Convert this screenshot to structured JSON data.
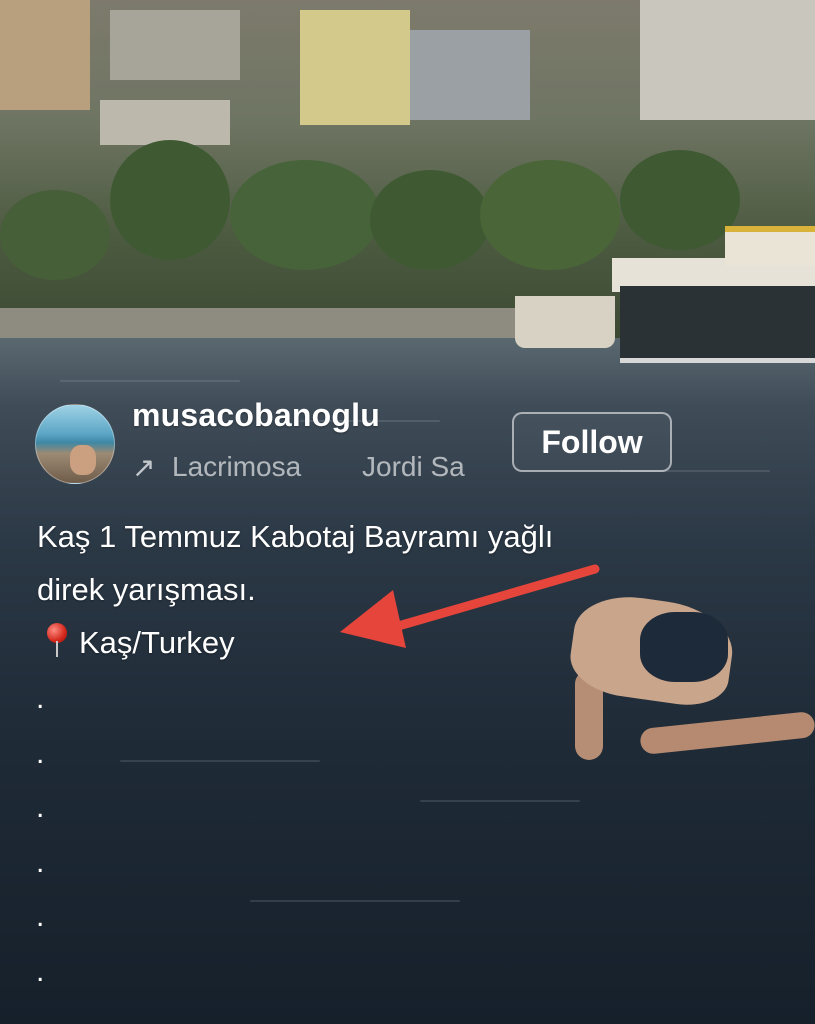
{
  "post": {
    "username": "musacobanoglu",
    "follow_label": "Follow",
    "audio": {
      "icon": "arrow-up-right-icon",
      "icon_glyph": "↗",
      "track_part_1": "Lacrimosa",
      "track_part_2": "Jordi Sa"
    },
    "caption_line_1": "Kaş 1 Temmuz Kabotaj Bayramı yağlı",
    "caption_line_2": "direk yarışması.",
    "location_icon": "round-pushpin-icon",
    "location_text": "Kaş/Turkey",
    "dots": [
      ".",
      ".",
      ".",
      ".",
      ".",
      "."
    ]
  },
  "annotation": {
    "arrow_color": "#e5453b"
  }
}
